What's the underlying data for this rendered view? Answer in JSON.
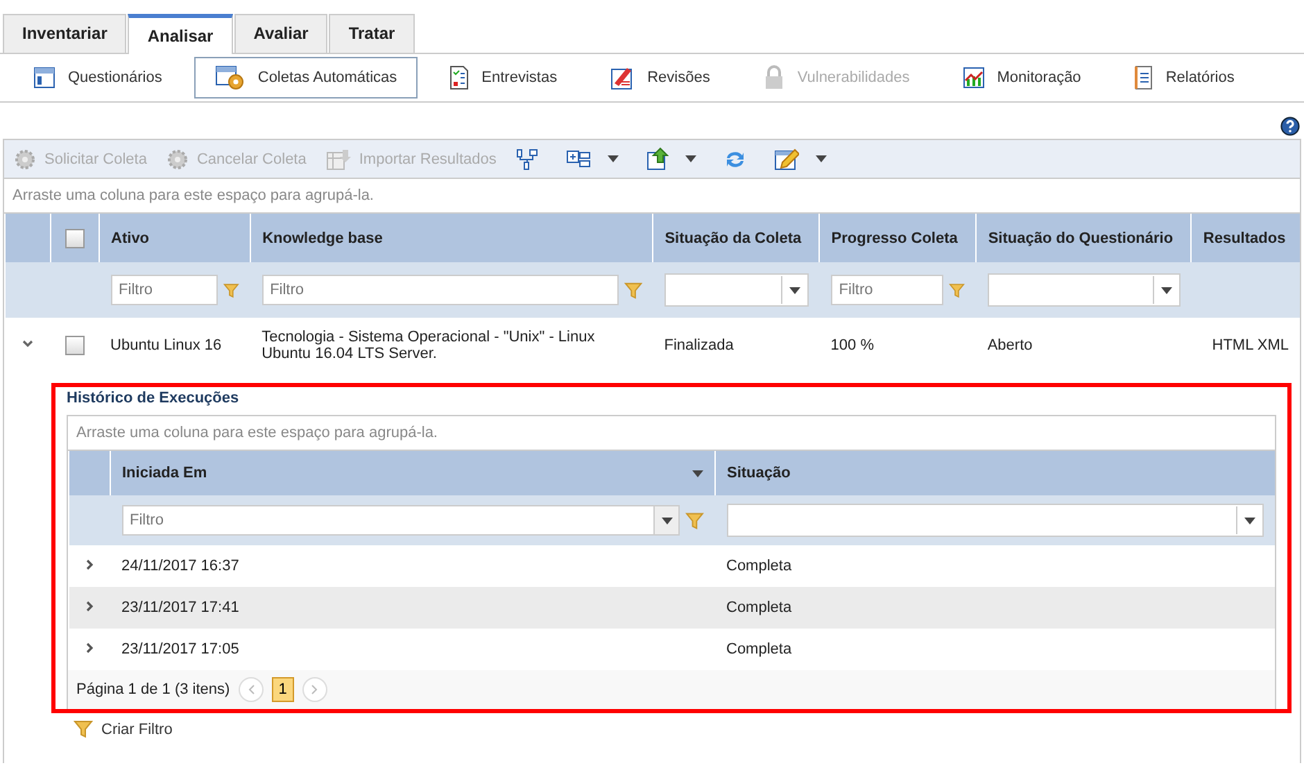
{
  "tabs": [
    {
      "label": "Inventariar",
      "selected": false
    },
    {
      "label": "Analisar",
      "selected": true
    },
    {
      "label": "Avaliar",
      "selected": false
    },
    {
      "label": "Tratar",
      "selected": false
    }
  ],
  "subnav": [
    {
      "label": "Questionários",
      "selected": false,
      "disabled": false
    },
    {
      "label": "Coletas Automáticas",
      "selected": true,
      "disabled": false
    },
    {
      "label": "Entrevistas",
      "selected": false,
      "disabled": false
    },
    {
      "label": "Revisões",
      "selected": false,
      "disabled": false
    },
    {
      "label": "Vulnerabilidades",
      "selected": false,
      "disabled": true
    },
    {
      "label": "Monitoração",
      "selected": false,
      "disabled": false
    },
    {
      "label": "Relatórios",
      "selected": false,
      "disabled": false
    }
  ],
  "toolbar": [
    {
      "kind": "button",
      "label": "Solicitar Coleta",
      "disabled": true
    },
    {
      "kind": "button",
      "label": "Cancelar Coleta",
      "disabled": true
    },
    {
      "kind": "button",
      "label": "Importar Resultados",
      "disabled": true
    },
    {
      "kind": "icon",
      "dropdown": false
    },
    {
      "kind": "icon",
      "dropdown": true
    },
    {
      "kind": "icon",
      "dropdown": true
    },
    {
      "kind": "icon",
      "dropdown": false
    },
    {
      "kind": "icon",
      "dropdown": true
    }
  ],
  "grid": {
    "group_hint": "Arraste uma coluna para este espaço para agrupá-la.",
    "select_all": false,
    "columns": [
      {
        "label": "Ativo"
      },
      {
        "label": "Knowledge base"
      },
      {
        "label": "Situação da Coleta"
      },
      {
        "label": "Progresso Coleta"
      },
      {
        "label": "Situação do Questionário"
      },
      {
        "label": "Resultados"
      }
    ],
    "filters": [
      {
        "kind": "text",
        "placeholder": "Filtro"
      },
      {
        "kind": "text",
        "placeholder": "Filtro"
      },
      {
        "kind": "select"
      },
      {
        "kind": "text",
        "placeholder": "Filtro"
      },
      {
        "kind": "select"
      },
      {
        "kind": "none"
      }
    ],
    "rows": [
      {
        "expanded": true,
        "checked": false,
        "cells": [
          "Ubuntu Linux 16",
          "Tecnologia - Sistema Operacional - \"Unix\" - Linux Ubuntu 16.04 LTS Server.",
          "Finalizada",
          "100 %",
          "Aberto"
        ],
        "links": [
          "HTML",
          "XML"
        ]
      }
    ]
  },
  "detail": {
    "title": "Histórico de Execuções",
    "group_hint": "Arraste uma coluna para este espaço para agrupá-la.",
    "columns": [
      {
        "label": "Iniciada Em",
        "menu": true
      },
      {
        "label": "Situação",
        "menu": false
      }
    ],
    "filters": [
      {
        "kind": "combo",
        "placeholder": "Filtro"
      },
      {
        "kind": "select"
      }
    ],
    "rows": [
      {
        "expanded": false,
        "highlighted": false,
        "cells": [
          "24/11/2017 16:37",
          "Completa"
        ]
      },
      {
        "expanded": false,
        "highlighted": true,
        "cells": [
          "23/11/2017 17:41",
          "Completa"
        ]
      },
      {
        "expanded": false,
        "highlighted": false,
        "cells": [
          "23/11/2017 17:05",
          "Completa"
        ]
      }
    ],
    "pager": {
      "summary": "Página 1 de 1 (3 itens)",
      "pages": [
        {
          "label": "1",
          "selected": true
        }
      ]
    }
  },
  "create_filter": "Criar Filtro"
}
